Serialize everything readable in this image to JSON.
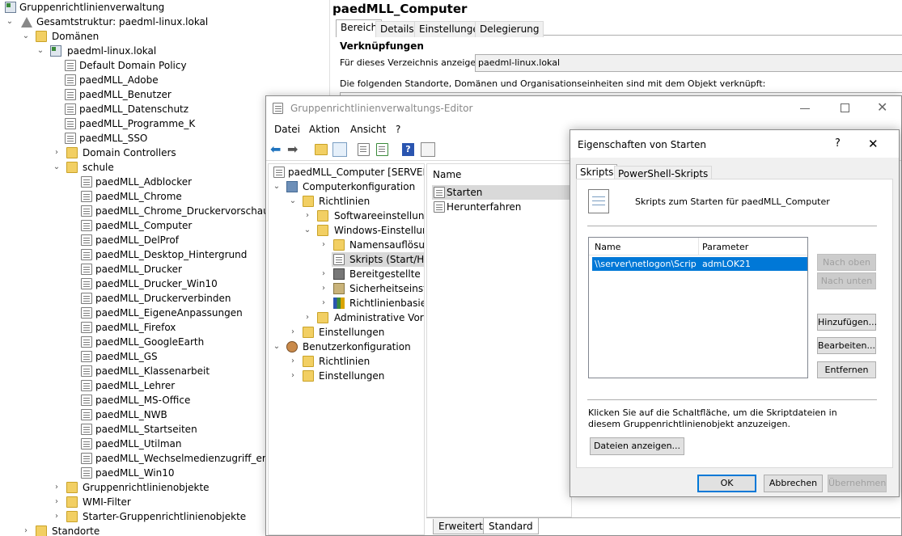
{
  "left_tree": {
    "root": "Gruppenrichtlinienverwaltung",
    "forest": "Gesamtstruktur: paedml-linux.lokal",
    "domains": "Domänen",
    "domain": "paedml-linux.lokal",
    "domain_gpos": [
      "Default Domain Policy",
      "paedMLL_Adobe",
      "paedMLL_Benutzer",
      "paedMLL_Datenschutz",
      "paedMLL_Programme_K",
      "paedMLL_SSO"
    ],
    "domain_controllers": "Domain Controllers",
    "schule": "schule",
    "schule_gpos": [
      "paedMLL_Adblocker",
      "paedMLL_Chrome",
      "paedMLL_Chrome_Druckervorschau",
      "paedMLL_Computer",
      "paedMLL_DelProf",
      "paedMLL_Desktop_Hintergrund",
      "paedMLL_Drucker",
      "paedMLL_Drucker_Win10",
      "paedMLL_Druckerverbinden",
      "paedMLL_EigeneAnpassungen",
      "paedMLL_Firefox",
      "paedMLL_GoogleEarth",
      "paedMLL_GS",
      "paedMLL_Klassenarbeit",
      "paedMLL_Lehrer",
      "paedMLL_MS-Office",
      "paedMLL_NWB",
      "paedMLL_Startseiten",
      "paedMLL_Utilman",
      "paedMLL_Wechselmedienzugriff_erlaub",
      "paedMLL_Win10"
    ],
    "selected_gpo": "paedMLL_Computer",
    "gpo_objects": "Gruppenrichtlinienobjekte",
    "wmi": "WMI-Filter",
    "starter": "Starter-Gruppenrichtlinienobjekte",
    "sites": "Standorte"
  },
  "right_panel": {
    "title": "paedMLL_Computer",
    "tabs": [
      "Bereich",
      "Details",
      "Einstellungen",
      "Delegierung"
    ],
    "active_tab": "Bereich",
    "section_title": "Verknüpfungen",
    "show_label": "Für dieses Verzeichnis anzeigen:",
    "show_value": "paedml-linux.lokal",
    "linked_text": "Die folgenden Standorte, Domänen und Organisationseinheiten sind mit dem Objekt verknüpft:"
  },
  "editor": {
    "title": "Gruppenrichtlinienverwaltungs-Editor",
    "menu": [
      "Datei",
      "Aktion",
      "Ansicht",
      "?"
    ],
    "tree": {
      "root": "paedMLL_Computer [SERVER.PA",
      "computer_config": "Computerkonfiguration",
      "policies": "Richtlinien",
      "software": "Softwareeinstellunge",
      "windows": "Windows-Einstellung",
      "names": "Namensauflösun",
      "scripts": "Skripts (Start/Her",
      "printers": "Bereitgestellte Dr",
      "security": "Sicherheitseinstel",
      "policy_based": "Richtlinienbasiert",
      "admin_templates": "Administrative Vorlag",
      "settings": "Einstellungen",
      "user_config": "Benutzerkonfiguration",
      "user_policies": "Richtlinien",
      "user_settings": "Einstellungen"
    },
    "list_header": "Name",
    "list_items": [
      "Starten",
      "Herunterfahren"
    ],
    "bottom_tabs": [
      "Erweitert",
      "Standard"
    ]
  },
  "dialog": {
    "title": "Eigenschaften von Starten",
    "help_glyph": "?",
    "close_glyph": "✕",
    "tabs": [
      "Skripts",
      "PowerShell-Skripts"
    ],
    "active_tab": "Skripts",
    "heading": "Skripts zum Starten für paedMLL_Computer",
    "columns": [
      "Name",
      "Parameter"
    ],
    "rows": [
      {
        "name": "\\\\server\\netlogon\\Script...",
        "param": "admLOK21"
      }
    ],
    "buttons": {
      "up": "Nach oben",
      "down": "Nach unten",
      "add": "Hinzufügen...",
      "edit": "Bearbeiten...",
      "remove": "Entfernen",
      "show_files": "Dateien anzeigen...",
      "ok": "OK",
      "cancel": "Abbrechen",
      "apply": "Übernehmen"
    },
    "info_text": "Klicken Sie auf die Schaltfläche, um die Skriptdateien in diesem Gruppenrichtlinienobjekt anzuzeigen."
  },
  "colors": {
    "selection": "#cce8ff",
    "row_selected": "#0078d7",
    "accent": "#0078d7"
  }
}
